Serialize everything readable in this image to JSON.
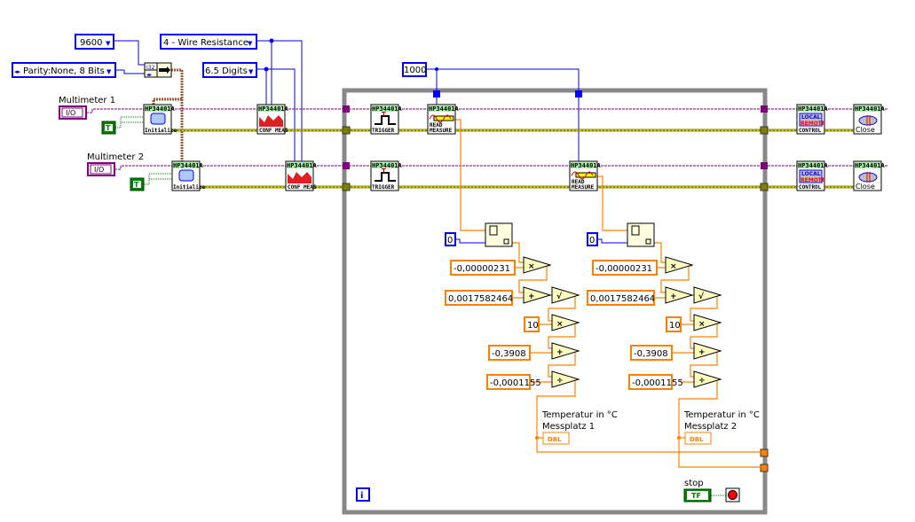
{
  "controls": {
    "baud_rate": "9600",
    "parity": "Parity:None, 8 Bits",
    "function": "4 - Wire Resistance",
    "resolution": "6.5 Digits",
    "loop_delay": "1000"
  },
  "instruments": [
    {
      "label": "Multimeter 1",
      "io": "I/O",
      "bool": "T"
    },
    {
      "label": "Multimeter 2",
      "io": "I/O",
      "bool": "T"
    }
  ],
  "nodes": {
    "header": "HP34401A",
    "initialize": "Initialize",
    "config": "CONF MEAS",
    "trigger": "TRIGGER",
    "read": "READ MEASURE",
    "control": "CONTROL",
    "local": "LOCAL",
    "remote": "REMOTE",
    "close": "Close",
    "bundle_type": "I32"
  },
  "channels": [
    {
      "index": "0",
      "constants": [
        "-0,00000231",
        "0,0017582464",
        "10",
        "-0,3908",
        "-0,0001155"
      ],
      "operators": [
        "×",
        "+",
        "√",
        "×",
        "+",
        "÷"
      ],
      "indicator_label_1": "Temperatur in °C",
      "indicator_label_2": "Messplatz 1",
      "indicator_type": "DBL"
    },
    {
      "index": "0",
      "constants": [
        "-0,00000231",
        "0,0017582464",
        "10",
        "-0,3908",
        "-0,0001155"
      ],
      "operators": [
        "×",
        "+",
        "√",
        "×",
        "+",
        "÷"
      ],
      "indicator_label_1": "Temperatur in °C",
      "indicator_label_2": "Messplatz 2",
      "indicator_type": "DBL"
    }
  ],
  "stop": {
    "label": "stop",
    "value": "TF"
  },
  "info_icon": "i",
  "colors": {
    "integer_wire": "#0000ff",
    "double_wire": "#ff8000",
    "visa_wire": "#800080",
    "error_wire": "#a0a000",
    "boolean": "#008000",
    "cluster_wire": "#a0522d",
    "loop_border": "#888888"
  }
}
